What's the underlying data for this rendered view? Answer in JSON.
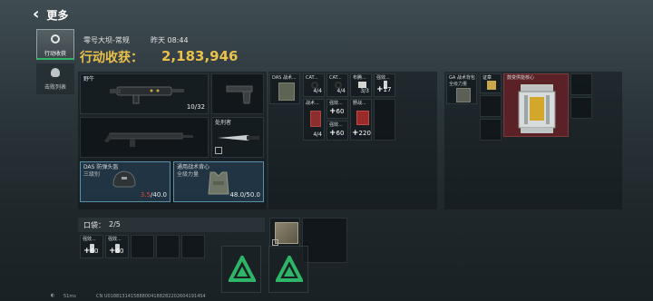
{
  "header": {
    "back_label": "更多"
  },
  "sidebar": {
    "items": [
      {
        "label": "行动收获",
        "icon": "target-icon",
        "active": true
      },
      {
        "label": "击败列表",
        "icon": "skull-icon",
        "active": false
      }
    ]
  },
  "raid": {
    "map_mode": "零号大坝-常规",
    "time": "昨天 08:44",
    "gain_label": "行动收获：",
    "gain_value": "2,183,946"
  },
  "gear": {
    "primary_weapon": {
      "name": "野牛",
      "ammo": "10/32"
    },
    "melee": {
      "name": "处刑者"
    },
    "helmet": {
      "name": "DAS 防弹头盔",
      "sub": "三级别",
      "durability_current": "3.5",
      "durability_max": "/40.0"
    },
    "armor": {
      "name": "通用战术背心",
      "sub": "全级力量",
      "durability": "48.0/50.0"
    }
  },
  "pocket": {
    "label": "口袋：",
    "count": "2/5",
    "items": [
      {
        "name": "强效...",
        "amount": "60"
      },
      {
        "name": "强效...",
        "amount": "60"
      }
    ]
  },
  "rig": {
    "slot_label": "DAS 战术...",
    "items": [
      {
        "name": "CAT...",
        "count": "4/4"
      },
      {
        "name": "CAT...",
        "count": "4/4"
      },
      {
        "name": "布腾...",
        "count": "3/3"
      },
      {
        "name": "强效...",
        "amount": "17"
      },
      {
        "name": "战术...",
        "count": "4/4"
      },
      {
        "name": "强效...",
        "amount": "60"
      },
      {
        "name": "强效...",
        "amount": "60"
      },
      {
        "name": "野战...",
        "amount": "220"
      }
    ]
  },
  "backpack": {
    "slot_label": "GA 战术背包",
    "slot_sub": "全级力量",
    "items": [
      {
        "name": "证章"
      },
      {
        "name": "鼓变供能核心"
      }
    ]
  },
  "footer": {
    "ping": "51ms",
    "uid": "CN U01881314158880041882822026041914S4"
  },
  "colors": {
    "gold": "#e8c04a",
    "red": "#e0443a",
    "highlight_red": "#5a2226",
    "cyan_border": "#5a8fa8",
    "accent_green": "#2fb567"
  }
}
